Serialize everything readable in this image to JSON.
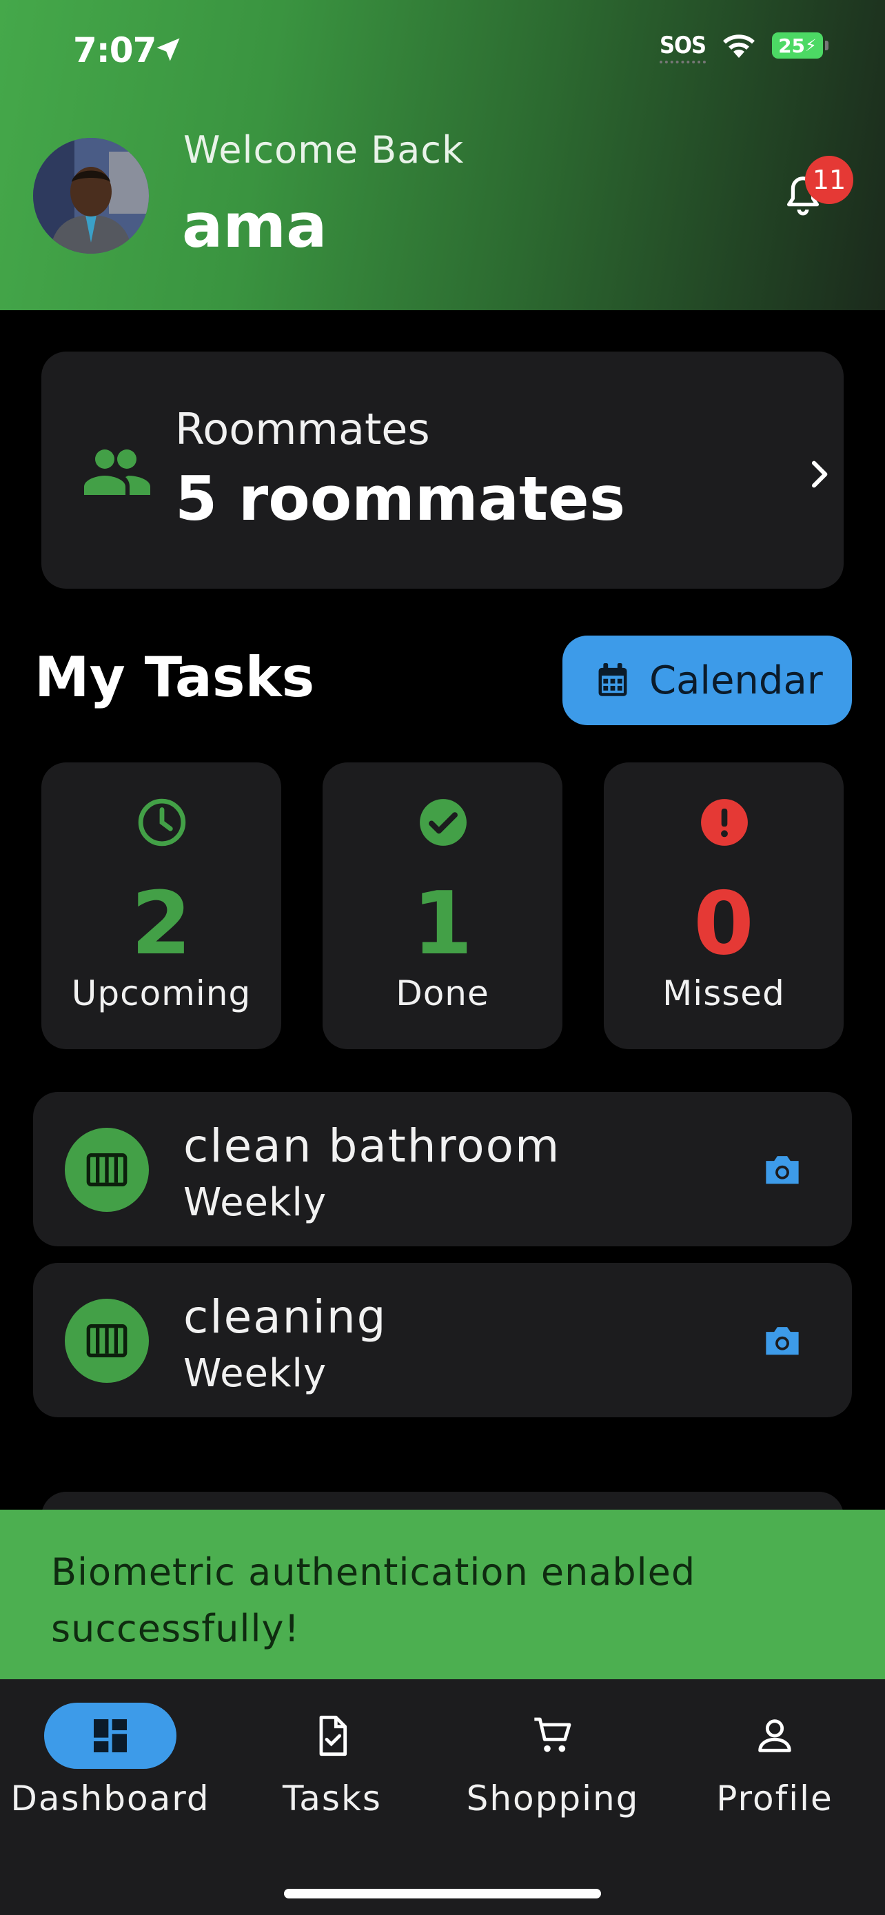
{
  "status": {
    "time": "7:07",
    "sos": "SOS",
    "battery": "25"
  },
  "header": {
    "welcome": "Welcome Back",
    "username": "ama",
    "notification_count": "11"
  },
  "roommates": {
    "label": "Roommates",
    "value": "5 roommates"
  },
  "tasks_section": {
    "title": "My Tasks",
    "calendar_label": "Calendar"
  },
  "stats": [
    {
      "value": "2",
      "label": "Upcoming"
    },
    {
      "value": "1",
      "label": "Done"
    },
    {
      "value": "0",
      "label": "Missed"
    }
  ],
  "tasks": [
    {
      "name": "clean bathroom",
      "frequency": "Weekly"
    },
    {
      "name": "cleaning",
      "frequency": "Weekly"
    }
  ],
  "snackbar": {
    "message": "Biometric authentication enabled successfully!"
  },
  "nav": [
    {
      "label": "Dashboard",
      "icon": "dashboard-icon",
      "active": true
    },
    {
      "label": "Tasks",
      "icon": "task-check-icon",
      "active": false
    },
    {
      "label": "Shopping",
      "icon": "cart-icon",
      "active": false
    },
    {
      "label": "Profile",
      "icon": "person-icon",
      "active": false
    }
  ],
  "colors": {
    "accent_green": "#43a047",
    "accent_blue": "#3d9be9",
    "missed_red": "#e53935",
    "card": "#1c1c1e"
  }
}
